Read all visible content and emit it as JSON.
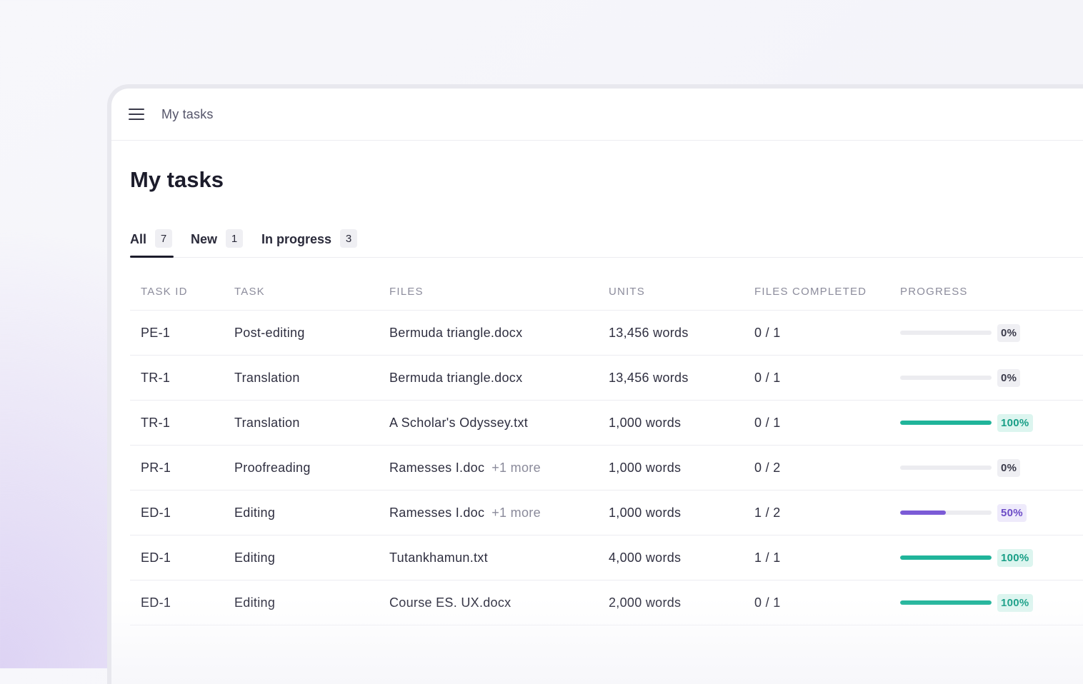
{
  "topbar": {
    "menu_icon": "hamburger-menu-icon",
    "title": "My tasks"
  },
  "page": {
    "title": "My tasks"
  },
  "tabs": [
    {
      "label": "All",
      "count": "7",
      "active": true
    },
    {
      "label": "New",
      "count": "1",
      "active": false
    },
    {
      "label": "In progress",
      "count": "3",
      "active": false
    }
  ],
  "table": {
    "headers": {
      "task_id": "TASK ID",
      "task": "TASK",
      "files": "FILES",
      "units": "UNITS",
      "files_completed": "FILES COMPLETED",
      "progress": "PROGRESS"
    },
    "rows": [
      {
        "task_id": "PE-1",
        "task": "Post-editing",
        "file": "Bermuda triangle.docx",
        "more": "",
        "units": "13,456 words",
        "files_completed": "0 / 1",
        "progress_label": "0%",
        "progress": 0,
        "status": "zero"
      },
      {
        "task_id": "TR-1",
        "task": "Translation",
        "file": "Bermuda triangle.docx",
        "more": "",
        "units": "13,456 words",
        "files_completed": "0 / 1",
        "progress_label": "0%",
        "progress": 0,
        "status": "zero"
      },
      {
        "task_id": "TR-1",
        "task": "Translation",
        "file": "A Scholar's Odyssey.txt",
        "more": "",
        "units": "1,000 words",
        "files_completed": "0 / 1",
        "progress_label": "100%",
        "progress": 1,
        "status": "full"
      },
      {
        "task_id": "PR-1",
        "task": "Proofreading",
        "file": "Ramesses I.doc",
        "more": "+1 more",
        "units": "1,000 words",
        "files_completed": "0 / 2",
        "progress_label": "0%",
        "progress": 0,
        "status": "zero"
      },
      {
        "task_id": "ED-1",
        "task": "Editing",
        "file": "Ramesses I.doc",
        "more": "+1 more",
        "units": "1,000 words",
        "files_completed": "1 / 2",
        "progress_label": "50%",
        "progress": 0.5,
        "status": "half"
      },
      {
        "task_id": "ED-1",
        "task": "Editing",
        "file": "Tutankhamun.txt",
        "more": "",
        "units": "4,000 words",
        "files_completed": "1 / 1",
        "progress_label": "100%",
        "progress": 1,
        "status": "full"
      },
      {
        "task_id": "ED-1",
        "task": "Editing",
        "file": "Course ES. UX.docx",
        "more": "",
        "units": "2,000 words",
        "files_completed": "0 / 1",
        "progress_label": "100%",
        "progress": 1,
        "status": "full"
      }
    ]
  },
  "colors": {
    "progress_full": "#20b49a",
    "progress_half": "#7b5bd6",
    "progress_track": "#ececf0",
    "title_text": "#1c1c2b"
  }
}
